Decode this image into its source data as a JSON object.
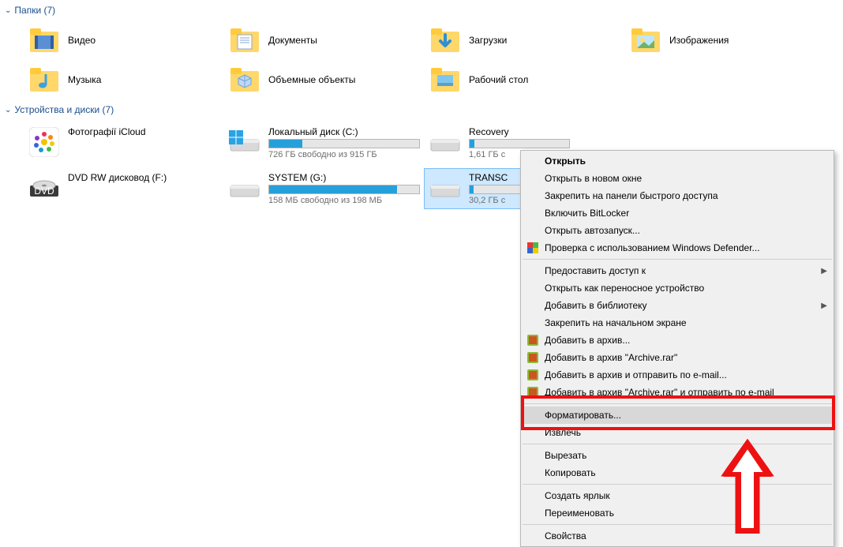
{
  "sections": {
    "folders": {
      "title": "Папки",
      "count": "(7)"
    },
    "drives": {
      "title": "Устройства и диски",
      "count": "(7)"
    }
  },
  "folders": [
    {
      "label": "Видео",
      "icon": "video"
    },
    {
      "label": "Документы",
      "icon": "doc"
    },
    {
      "label": "Загрузки",
      "icon": "download"
    },
    {
      "label": "Изображения",
      "icon": "image"
    },
    {
      "label": "Музыка",
      "icon": "music"
    },
    {
      "label": "Объемные объекты",
      "icon": "3d"
    },
    {
      "label": "Рабочий стол",
      "icon": "desktop"
    }
  ],
  "drives": [
    {
      "name": "Фотографії iCloud",
      "icon": "icloud",
      "bar": null,
      "sub": ""
    },
    {
      "name": "Локальный диск (C:)",
      "icon": "ssd-win",
      "bar": 22,
      "sub": "726 ГБ свободно из 915 ГБ"
    },
    {
      "name": "Recovery",
      "icon": "ssd",
      "bar": 5,
      "sub": "1,61 ГБ с"
    },
    {
      "name": "DVD RW дисковод (F:)",
      "icon": "dvd",
      "bar": null,
      "sub": ""
    },
    {
      "name": "SYSTEM (G:)",
      "icon": "ssd",
      "bar": 85,
      "sub": "158 МБ свободно из 198 МБ"
    },
    {
      "name": "TRANSC",
      "icon": "ssd",
      "bar": 4,
      "sub": "30,2 ГБ с",
      "selected": true
    }
  ],
  "ctx": {
    "open": "Открыть",
    "open_new": "Открыть в новом окне",
    "pin_quick": "Закрепить на панели быстрого доступа",
    "bitlocker": "Включить BitLocker",
    "autoplay": "Открыть автозапуск...",
    "defender": "Проверка с использованием Windows Defender...",
    "share": "Предоставить доступ к",
    "portable": "Открыть как переносное устройство",
    "library": "Добавить в библиотеку",
    "pin_start": "Закрепить на начальном экране",
    "rar1": "Добавить в архив...",
    "rar2": "Добавить в архив \"Archive.rar\"",
    "rar3": "Добавить в архив и отправить по e-mail...",
    "rar4": "Добавить в архив \"Archive.rar\" и отправить по e-mail",
    "format": "Форматировать...",
    "eject": "Извлечь",
    "cut": "Вырезать",
    "copy": "Копировать",
    "shortcut": "Создать ярлык",
    "rename": "Переименовать",
    "props": "Свойства"
  }
}
